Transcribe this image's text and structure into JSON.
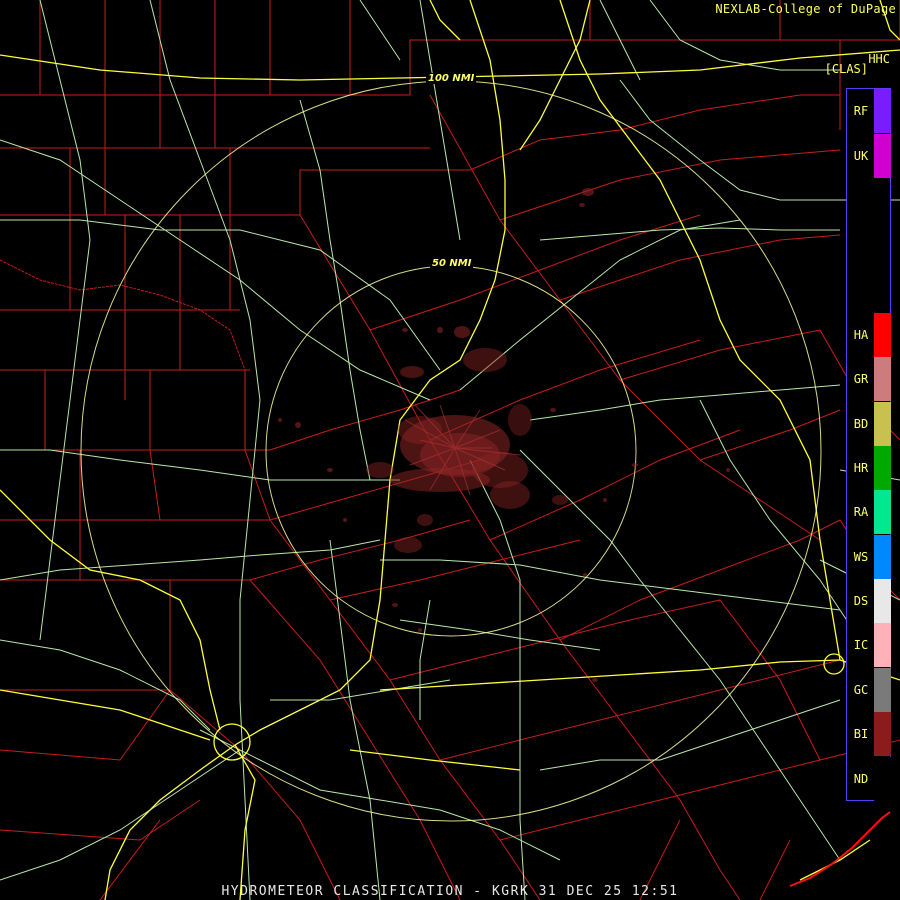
{
  "header": {
    "credit": "NEXLAB-College of DuPage",
    "product_code": "HHC",
    "class_label": "[CLAS]"
  },
  "rings": {
    "outer_label": "100 NMI",
    "inner_label": "50 NMI"
  },
  "footer": {
    "caption": "HYDROMETEOR CLASSIFICATION - KGRK 31 DEC 25 12:51"
  },
  "legend": [
    {
      "code": "RF",
      "color": "#7a1cff"
    },
    {
      "code": "UK",
      "color": "#d100d1"
    },
    {
      "code": "HA",
      "color": "#ff0000"
    },
    {
      "code": "GR",
      "color": "#cc7c7c"
    },
    {
      "code": "BD",
      "color": "#c8c050"
    },
    {
      "code": "HR",
      "color": "#00a800"
    },
    {
      "code": "RA",
      "color": "#00e890"
    },
    {
      "code": "WS",
      "color": "#0088ff"
    },
    {
      "code": "DS",
      "color": "#e8e8e8"
    },
    {
      "code": "IC",
      "color": "#ffb0b8"
    },
    {
      "code": "GC",
      "color": "#7a7a7a"
    },
    {
      "code": "BI",
      "color": "#8a1c1c"
    },
    {
      "code": "ND",
      "color": "#000000"
    }
  ],
  "colors": {
    "county_lines": "#d02020",
    "highways": "#c8e8a0",
    "interstates": "#ffff40",
    "range_rings": "#ffffa0",
    "echoes": "#8c2424",
    "coast": "#ff1010"
  }
}
